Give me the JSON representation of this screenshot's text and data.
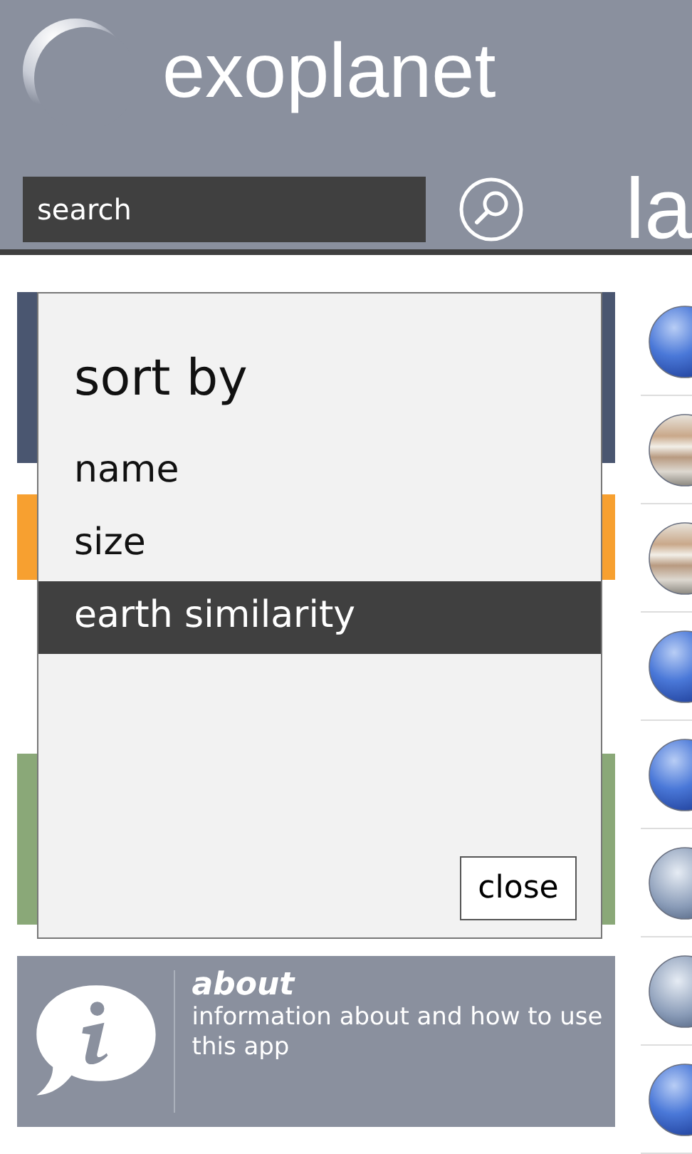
{
  "app": {
    "title": "exoplanet"
  },
  "search": {
    "placeholder": "search"
  },
  "pivot_header": "la",
  "tiles": [
    {
      "kind": "plain",
      "color": "#4a5670"
    },
    {
      "kind": "plain",
      "color": "#f7a030"
    },
    {
      "kind": "plain",
      "color": "#8aa878"
    },
    {
      "kind": "about",
      "color": "#8a909e",
      "title": "about",
      "description": "information about and how to use this app"
    }
  ],
  "planets": [
    {
      "kind": "blue"
    },
    {
      "kind": "banded"
    },
    {
      "kind": "banded"
    },
    {
      "kind": "blue"
    },
    {
      "kind": "blue"
    },
    {
      "kind": "cloudy"
    },
    {
      "kind": "cloudy"
    },
    {
      "kind": "blue"
    }
  ],
  "dialog": {
    "title": "sort by",
    "options": [
      {
        "label": "name",
        "selected": false
      },
      {
        "label": "size",
        "selected": false
      },
      {
        "label": "earth similarity",
        "selected": true
      }
    ],
    "close_button": "close"
  }
}
